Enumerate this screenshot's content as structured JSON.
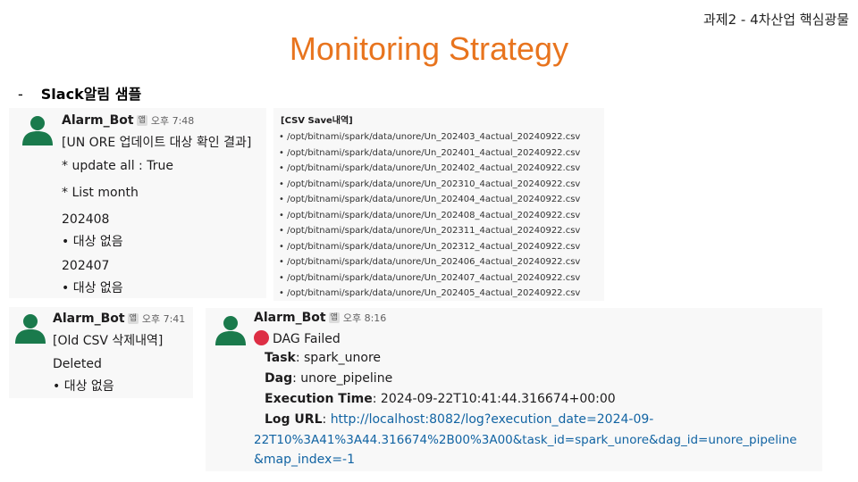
{
  "header": {
    "corner_label": "과제2 - 4차산업 핵심광물",
    "title": "Monitoring Strategy",
    "bullet_dash": "-",
    "bullet_text": "Slack알림 샘플"
  },
  "card1": {
    "bot_name": "Alarm_Bot",
    "app_badge": "앱",
    "time": "오후 7:48",
    "heading": "[UN ORE 업데이트 대상 확인 결과]",
    "update_all_label": "* update all :",
    "update_all_value": " True",
    "list_month_label": "* List month",
    "month_1": "202408",
    "month_1_item": "• 대상 없음",
    "month_2": "202407",
    "month_2_item": "• 대상 없음"
  },
  "csv_panel": {
    "title": "[CSV Save내역]",
    "files": [
      "/opt/bitnami/spark/data/unore/Un_202403_4actual_20240922.csv",
      "/opt/bitnami/spark/data/unore/Un_202401_4actual_20240922.csv",
      "/opt/bitnami/spark/data/unore/Un_202402_4actual_20240922.csv",
      "/opt/bitnami/spark/data/unore/Un_202310_4actual_20240922.csv",
      "/opt/bitnami/spark/data/unore/Un_202404_4actual_20240922.csv",
      "/opt/bitnami/spark/data/unore/Un_202408_4actual_20240922.csv",
      "/opt/bitnami/spark/data/unore/Un_202311_4actual_20240922.csv",
      "/opt/bitnami/spark/data/unore/Un_202312_4actual_20240922.csv",
      "/opt/bitnami/spark/data/unore/Un_202406_4actual_20240922.csv",
      "/opt/bitnami/spark/data/unore/Un_202407_4actual_20240922.csv",
      "/opt/bitnami/spark/data/unore/Un_202405_4actual_20240922.csv"
    ]
  },
  "card2": {
    "bot_name": "Alarm_Bot",
    "app_badge": "앱",
    "time": "오후 7:41",
    "heading": "[Old CSV 삭제내역]",
    "deleted_label": "Deleted",
    "deleted_item": "• 대상 없음"
  },
  "card3": {
    "bot_name": "Alarm_Bot",
    "app_badge": "앱",
    "time": "오후 8:16",
    "status": "DAG Failed",
    "task_label": "Task",
    "task_value": ": spark_unore",
    "dag_label": "Dag",
    "dag_value": ": unore_pipeline",
    "exec_label": "Execution Time",
    "exec_value": ": 2024-09-22T10:41:44.316674+00:00",
    "log_label": "Log URL",
    "log_sep": ": ",
    "log_url_1": "http://localhost:8082/log?execution_date=2024-09-",
    "log_url_2": "22T10%3A41%3A44.316674%2B00%3A00&task_id=spark_unore&dag_id=unore_pipeline",
    "log_url_3": "&map_index=-1"
  },
  "colors": {
    "title": "#e8741e",
    "avatar": "#1a7a4c",
    "link": "#1264a3",
    "error_dot": "#dd2e44"
  }
}
